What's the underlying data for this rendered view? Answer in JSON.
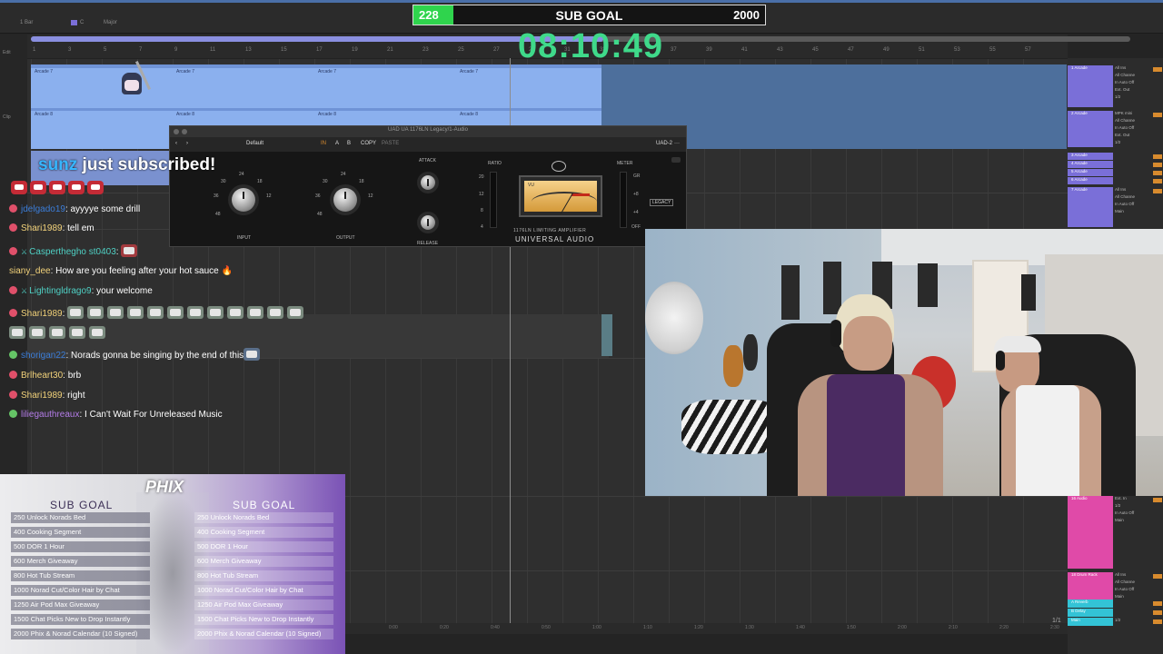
{
  "daw": {
    "topbar": {
      "bar_label": "1 Bar",
      "key": "C",
      "scale": "Major",
      "edit_label": "Edit"
    },
    "ruler_numbers": [
      "1",
      "3",
      "5",
      "7",
      "9",
      "11",
      "13",
      "15",
      "17",
      "19",
      "21",
      "23",
      "25",
      "27",
      "29",
      "31",
      "33",
      "35",
      "37",
      "39",
      "41",
      "43",
      "45",
      "47",
      "49",
      "51",
      "53",
      "55",
      "57"
    ],
    "clip_names_row1": [
      "Arcade 7",
      "Arcade 7",
      "Arcade 7",
      "Arcade 7"
    ],
    "clip_names_row2": [
      "Arcade 8",
      "Arcade 8",
      "Arcade 8",
      "Arcade 8"
    ],
    "bottom_ruler": [
      "0:00",
      "0:20",
      "0:40",
      "0:50",
      "1:00",
      "1:10",
      "1:20",
      "1:30",
      "1:40",
      "1:50",
      "2:00",
      "2:10",
      "2:20",
      "2:30"
    ],
    "page_indicator": "1/1",
    "left_labels": [
      "Edit",
      "Clip"
    ],
    "mixer_tracks": [
      {
        "name": "1 Arcade",
        "color": "#7a6fd8",
        "io": [
          "All Ins",
          "All Channe",
          "In Auto Off",
          "Ext. Out",
          "1/2"
        ]
      },
      {
        "name": "2 Arcade",
        "color": "#7a6fd8",
        "io": [
          "MPK mini",
          "All Channe",
          "In Auto Off",
          "Ext. Out",
          "1/2"
        ]
      },
      {
        "name": "3 Arcade",
        "color": "#7a6fd8",
        "io": []
      },
      {
        "name": "4 Arcade",
        "color": "#7a6fd8",
        "io": []
      },
      {
        "name": "5 Arcade",
        "color": "#7a6fd8",
        "io": []
      },
      {
        "name": "6 Arcade",
        "color": "#7a6fd8",
        "io": []
      },
      {
        "name": "7 Arcade",
        "color": "#7a6fd8",
        "io": [
          "All Ins",
          "All Channe",
          "In Auto Off",
          "Main"
        ]
      },
      {
        "name": "16 Audio",
        "color": "#e04aa8",
        "io": [
          "Ext. In",
          "1/2",
          "In Auto Off",
          "Main"
        ]
      },
      {
        "name": "18 Drum Rack",
        "color": "#e04aa8",
        "io": [
          "All Ins",
          "All Channe",
          "In Auto Off",
          "Main"
        ]
      },
      {
        "name": "A Reverb",
        "color": "#33c3d6",
        "io": []
      },
      {
        "name": "B Delay",
        "color": "#33c3d6",
        "io": []
      },
      {
        "name": "Main",
        "color": "#33c3d6",
        "io": [
          "1/2"
        ]
      }
    ]
  },
  "overlay": {
    "subgoal": {
      "current": "228",
      "title": "SUB GOAL",
      "target": "2000",
      "progress_fraction": 0.114
    },
    "timer": "08:10:49",
    "alert": {
      "user": "sunz",
      "message": " just subscribed!"
    }
  },
  "plugin": {
    "title": "UAD UA 1176LN Legacy/1-Audio",
    "preset": "Default",
    "toolbar": {
      "in": "IN",
      "a": "A",
      "b": "B",
      "copy": "COPY",
      "paste": "PASTE",
      "device": "UAD-2"
    },
    "labels": {
      "input": "INPUT",
      "output": "OUTPUT",
      "attack": "ATTACK",
      "release": "RELEASE",
      "ratio": "RATIO",
      "meter": "METER"
    },
    "ratio_values": [
      "20",
      "12",
      "8",
      "4"
    ],
    "meter_values": [
      "GR",
      "+8",
      "+4",
      "OFF"
    ],
    "input_scale": [
      "24",
      "18",
      "12",
      "30",
      "36",
      "48"
    ],
    "output_scale": [
      "24",
      "18",
      "12",
      "30",
      "36",
      "48"
    ],
    "vu_label": "VU",
    "model_text": "1176LN LIMITING AMPLIFIER",
    "brand": "UNIVERSAL AUDIO",
    "badge": "LEGACY"
  },
  "chat": [
    {
      "user": "jdelgado19",
      "color": "#3b7dd8",
      "message": ": ayyyye some drill",
      "badge": "#e0506a"
    },
    {
      "user": "Shari1989",
      "color": "#f2d27a",
      "message": ": tell em",
      "badge": "#e0506a"
    },
    {
      "user": "Casperthegho st0403",
      "color": "#4fd1c5",
      "message": ":",
      "badge": "#e0506a"
    },
    {
      "user": "siany_dee",
      "color": "#f2d27a",
      "message": ": How are you feeling after your hot sauce 🔥",
      "badge": ""
    },
    {
      "user": "Lightingldrago9",
      "color": "#4fd1c5",
      "message": ": your welcome",
      "badge": "#e0506a"
    },
    {
      "user": "Shari1989",
      "color": "#f2d27a",
      "message": ":",
      "badge": "#e0506a"
    },
    {
      "user": "shorigan22",
      "color": "#3b7dd8",
      "message": ": Norads gonna be singing by the end of this",
      "badge": "#65c466"
    },
    {
      "user": "Brlheart30",
      "color": "#f2d27a",
      "message": ": brb",
      "badge": "#e0506a"
    },
    {
      "user": "Shari1989",
      "color": "#f2d27a",
      "message": ": right",
      "badge": "#e0506a"
    },
    {
      "user": "liliegauthreaux",
      "color": "#b47ce8",
      "message": ": I Can't Wait For Unreleased Music",
      "badge": "#65c466"
    }
  ],
  "goals": {
    "logo": "PHIX",
    "title": "SUB GOAL",
    "items": [
      "250 Unlock Norads Bed",
      "400 Cooking Segment",
      "500 DOR 1 Hour",
      "600 Merch Giveaway",
      "800 Hot Tub Stream",
      "1000 Norad Cut/Color Hair by Chat",
      "1250 Air Pod Max Giveaway",
      "1500 Chat Picks New to Drop Instantly",
      "2000 Phix & Norad Calendar (10 Signed)"
    ]
  }
}
